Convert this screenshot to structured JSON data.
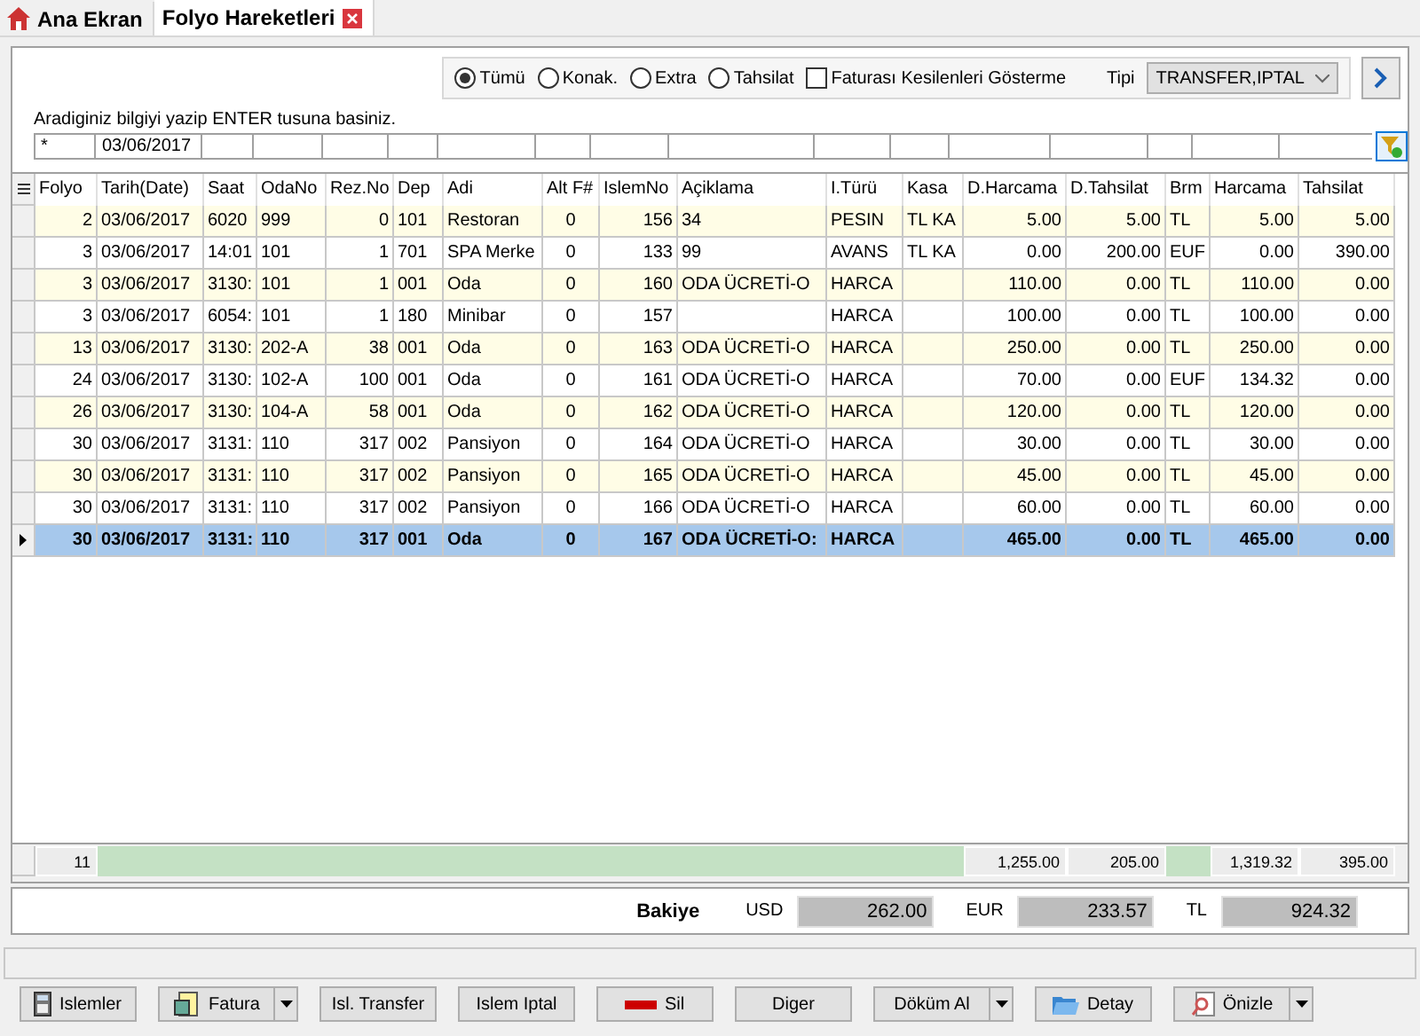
{
  "tabs": [
    {
      "label": "Ana Ekran",
      "selected": false,
      "closable": false
    },
    {
      "label": "Folyo Hareketleri",
      "selected": true,
      "closable": true
    }
  ],
  "filter": {
    "radios": [
      {
        "label": "Tümü",
        "selected": true
      },
      {
        "label": "Konak.",
        "selected": false
      },
      {
        "label": "Extra",
        "selected": false
      },
      {
        "label": "Tahsilat",
        "selected": false
      }
    ],
    "checkbox": {
      "label": "Faturası Kesilenleri Gösterme",
      "checked": false
    },
    "type_label": "Tipi",
    "type_value": "TRANSFER,IPTAL"
  },
  "hint": "Aradiginiz bilgiyi yazip ENTER tusuna basiniz.",
  "search_row": {
    "folyo": "*",
    "tarih": "03/06/2017"
  },
  "table": {
    "columns": [
      "Folyo",
      "Tarih(Date)",
      "Saat",
      "OdaNo",
      "Rez.No",
      "Dep",
      "Adi",
      "Alt F#",
      "IslemNo",
      "Açiklama",
      "I.Türü",
      "Kasa",
      "D.Harcama",
      "D.Tahsilat",
      "Brm",
      "Harcama",
      "Tahsilat"
    ],
    "rows": [
      {
        "selected": false,
        "folyo": "2",
        "tarih": "03/06/2017",
        "saat": "6020",
        "oda_no": "999",
        "rez_no": "0",
        "dep": "101",
        "adi": "Restoran",
        "alt_f": "0",
        "islem_no": "156",
        "aciklama": "34",
        "i_turu": "PESIN",
        "kasa": "TL KA",
        "d_harcama": "5.00",
        "d_tahsilat": "5.00",
        "brm": "TL",
        "harcama": "5.00",
        "tahsilat": "5.00"
      },
      {
        "selected": false,
        "folyo": "3",
        "tarih": "03/06/2017",
        "saat": "14:01",
        "oda_no": "101",
        "rez_no": "1",
        "dep": "701",
        "adi": "SPA Merke",
        "alt_f": "0",
        "islem_no": "133",
        "aciklama": "99",
        "i_turu": "AVANS",
        "kasa": "TL KA",
        "d_harcama": "0.00",
        "d_tahsilat": "200.00",
        "brm": "EUF",
        "harcama": "0.00",
        "tahsilat": "390.00"
      },
      {
        "selected": false,
        "folyo": "3",
        "tarih": "03/06/2017",
        "saat": "3130:",
        "oda_no": "101",
        "rez_no": "1",
        "dep": "001",
        "adi": "Oda",
        "alt_f": "0",
        "islem_no": "160",
        "aciklama": "ODA ÜCRETİ-O",
        "i_turu": "HARCA",
        "d_harcama": "110.00",
        "d_tahsilat": "0.00",
        "brm": "TL",
        "harcama": "110.00",
        "tahsilat": "0.00"
      },
      {
        "selected": false,
        "folyo": "3",
        "tarih": "03/06/2017",
        "saat": "6054:",
        "oda_no": "101",
        "rez_no": "1",
        "dep": "180",
        "adi": "Minibar",
        "alt_f": "0",
        "islem_no": "157",
        "i_turu": "HARCA",
        "d_harcama": "100.00",
        "d_tahsilat": "0.00",
        "brm": "TL",
        "harcama": "100.00",
        "tahsilat": "0.00"
      },
      {
        "selected": false,
        "folyo": "13",
        "tarih": "03/06/2017",
        "saat": "3130:",
        "oda_no": "202-A",
        "rez_no": "38",
        "dep": "001",
        "adi": "Oda",
        "alt_f": "0",
        "islem_no": "163",
        "aciklama": "ODA ÜCRETİ-O",
        "i_turu": "HARCA",
        "d_harcama": "250.00",
        "d_tahsilat": "0.00",
        "brm": "TL",
        "harcama": "250.00",
        "tahsilat": "0.00"
      },
      {
        "selected": false,
        "folyo": "24",
        "tarih": "03/06/2017",
        "saat": "3130:",
        "oda_no": "102-A",
        "rez_no": "100",
        "dep": "001",
        "adi": "Oda",
        "alt_f": "0",
        "islem_no": "161",
        "aciklama": "ODA ÜCRETİ-O",
        "i_turu": "HARCA",
        "d_harcama": "70.00",
        "d_tahsilat": "0.00",
        "brm": "EUF",
        "harcama": "134.32",
        "tahsilat": "0.00"
      },
      {
        "selected": false,
        "folyo": "26",
        "tarih": "03/06/2017",
        "saat": "3130:",
        "oda_no": "104-A",
        "rez_no": "58",
        "dep": "001",
        "adi": "Oda",
        "alt_f": "0",
        "islem_no": "162",
        "aciklama": "ODA ÜCRETİ-O",
        "i_turu": "HARCA",
        "d_harcama": "120.00",
        "d_tahsilat": "0.00",
        "brm": "TL",
        "harcama": "120.00",
        "tahsilat": "0.00"
      },
      {
        "selected": false,
        "folyo": "30",
        "tarih": "03/06/2017",
        "saat": "3131:",
        "oda_no": "110",
        "rez_no": "317",
        "dep": "002",
        "adi": "Pansiyon",
        "alt_f": "0",
        "islem_no": "164",
        "aciklama": "ODA ÜCRETİ-O",
        "i_turu": "HARCA",
        "d_harcama": "30.00",
        "d_tahsilat": "0.00",
        "brm": "TL",
        "harcama": "30.00",
        "tahsilat": "0.00"
      },
      {
        "selected": false,
        "folyo": "30",
        "tarih": "03/06/2017",
        "saat": "3131:",
        "oda_no": "110",
        "rez_no": "317",
        "dep": "002",
        "adi": "Pansiyon",
        "alt_f": "0",
        "islem_no": "165",
        "aciklama": "ODA ÜCRETİ-O",
        "i_turu": "HARCA",
        "d_harcama": "45.00",
        "d_tahsilat": "0.00",
        "brm": "TL",
        "harcama": "45.00",
        "tahsilat": "0.00"
      },
      {
        "selected": false,
        "folyo": "30",
        "tarih": "03/06/2017",
        "saat": "3131:",
        "oda_no": "110",
        "rez_no": "317",
        "dep": "002",
        "adi": "Pansiyon",
        "alt_f": "0",
        "islem_no": "166",
        "aciklama": "ODA ÜCRETİ-O",
        "i_turu": "HARCA",
        "d_harcama": "60.00",
        "d_tahsilat": "0.00",
        "brm": "TL",
        "harcama": "60.00",
        "tahsilat": "0.00"
      },
      {
        "selected": true,
        "folyo": "30",
        "tarih": "03/06/2017",
        "saat": "3131:",
        "oda_no": "110",
        "rez_no": "317",
        "dep": "001",
        "adi": "Oda",
        "alt_f": "0",
        "islem_no": "167",
        "aciklama": "ODA ÜCRETİ-O:",
        "i_turu": "HARCA",
        "d_harcama": "465.00",
        "d_tahsilat": "0.00",
        "brm": "TL",
        "harcama": "465.00",
        "tahsilat": "0.00"
      }
    ],
    "totals": {
      "folyo": "11",
      "d_harcama": "1,255.00",
      "d_tahsilat": "205.00",
      "harcama": "1,319.32",
      "tahsilat": "395.00"
    }
  },
  "balance": {
    "label": "Bakiye",
    "items": [
      {
        "currency": "USD",
        "amount": "262.00"
      },
      {
        "currency": "EUR",
        "amount": "233.57"
      },
      {
        "currency": "TL",
        "amount": "924.32"
      }
    ]
  },
  "buttons": [
    {
      "label": "Islemler",
      "kind": "calculator",
      "dropdown": false
    },
    {
      "label": "Fatura",
      "kind": "invoice",
      "dropdown": true
    },
    {
      "label": "Isl. Transfer",
      "kind": "plain",
      "dropdown": false
    },
    {
      "label": "Islem Iptal",
      "kind": "plain",
      "dropdown": false
    },
    {
      "label": "Sil",
      "kind": "delete",
      "dropdown": false
    },
    {
      "label": "Diger",
      "kind": "plain",
      "dropdown": false
    },
    {
      "label": "Döküm Al",
      "kind": "plain",
      "dropdown": true
    },
    {
      "label": "Detay",
      "kind": "folder",
      "dropdown": false
    },
    {
      "label": "Önizle",
      "kind": "preview",
      "dropdown": true
    }
  ]
}
